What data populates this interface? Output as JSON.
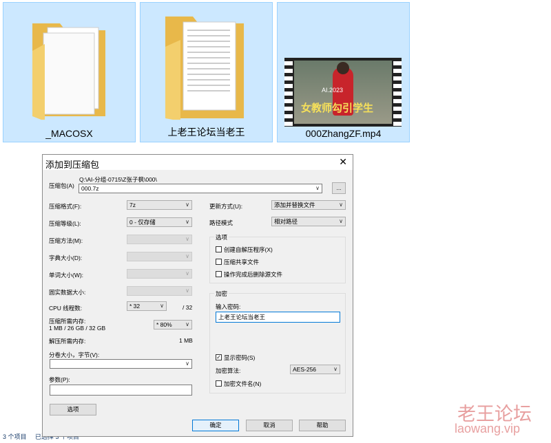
{
  "explorer": {
    "items": [
      {
        "name": "_MACOSX"
      },
      {
        "name": "上老王论坛当老王"
      },
      {
        "name": "000ZhangZF.mp4",
        "thumb_caption": "女教师勾引学生",
        "thumb_badge": "AI.2023"
      }
    ],
    "status": {
      "count": "3 个项目",
      "selected": "已选择 3 个项目"
    }
  },
  "dialog": {
    "title": "添加到压缩包",
    "close": "✕",
    "archive_label": "压缩包(A)",
    "archive_path": "Q:\\AI-分组-0715\\Z张子枫\\000\\",
    "archive_name": "000.7z",
    "browse": "...",
    "format_label": "压缩格式(F):",
    "format_value": "7z",
    "level_label": "压缩等级(L):",
    "level_value": "0 - 仅存储",
    "method_label": "压缩方法(M):",
    "dict_label": "字典大小(D):",
    "word_label": "单词大小(W):",
    "solid_label": "固实数据大小:",
    "cpu_label": "CPU 线程数:",
    "cpu_value": "* 32",
    "cpu_max": "/ 32",
    "mem_label": "压缩所需内存:",
    "mem_detail": "1 MB / 26 GB / 32 GB",
    "mem_value": "* 80%",
    "demem_label": "解压所需内存:",
    "demem_value": "1 MB",
    "split_label": "分卷大小，字节(V):",
    "params_label": "参数(P):",
    "options_button": "选项",
    "update_label": "更新方式(U):",
    "update_value": "添加并替换文件",
    "path_label": "路径模式",
    "path_value": "相对路径",
    "options_group": "选项",
    "opt_sfx": "创建自解压程序(X)",
    "opt_shared": "压缩共享文件",
    "opt_delete": "操作完成后删除源文件",
    "enc_group": "加密",
    "pwd_label": "输入密码:",
    "pwd_value": "上老王论坛当老王",
    "show_pwd": "显示密码(S)",
    "enc_method_label": "加密算法:",
    "enc_method_value": "AES-256",
    "enc_names": "加密文件名(N)",
    "ok": "确定",
    "cancel": "取消",
    "help": "帮助"
  },
  "watermark": {
    "cn": "老王论坛",
    "en": "laowang.vip"
  }
}
